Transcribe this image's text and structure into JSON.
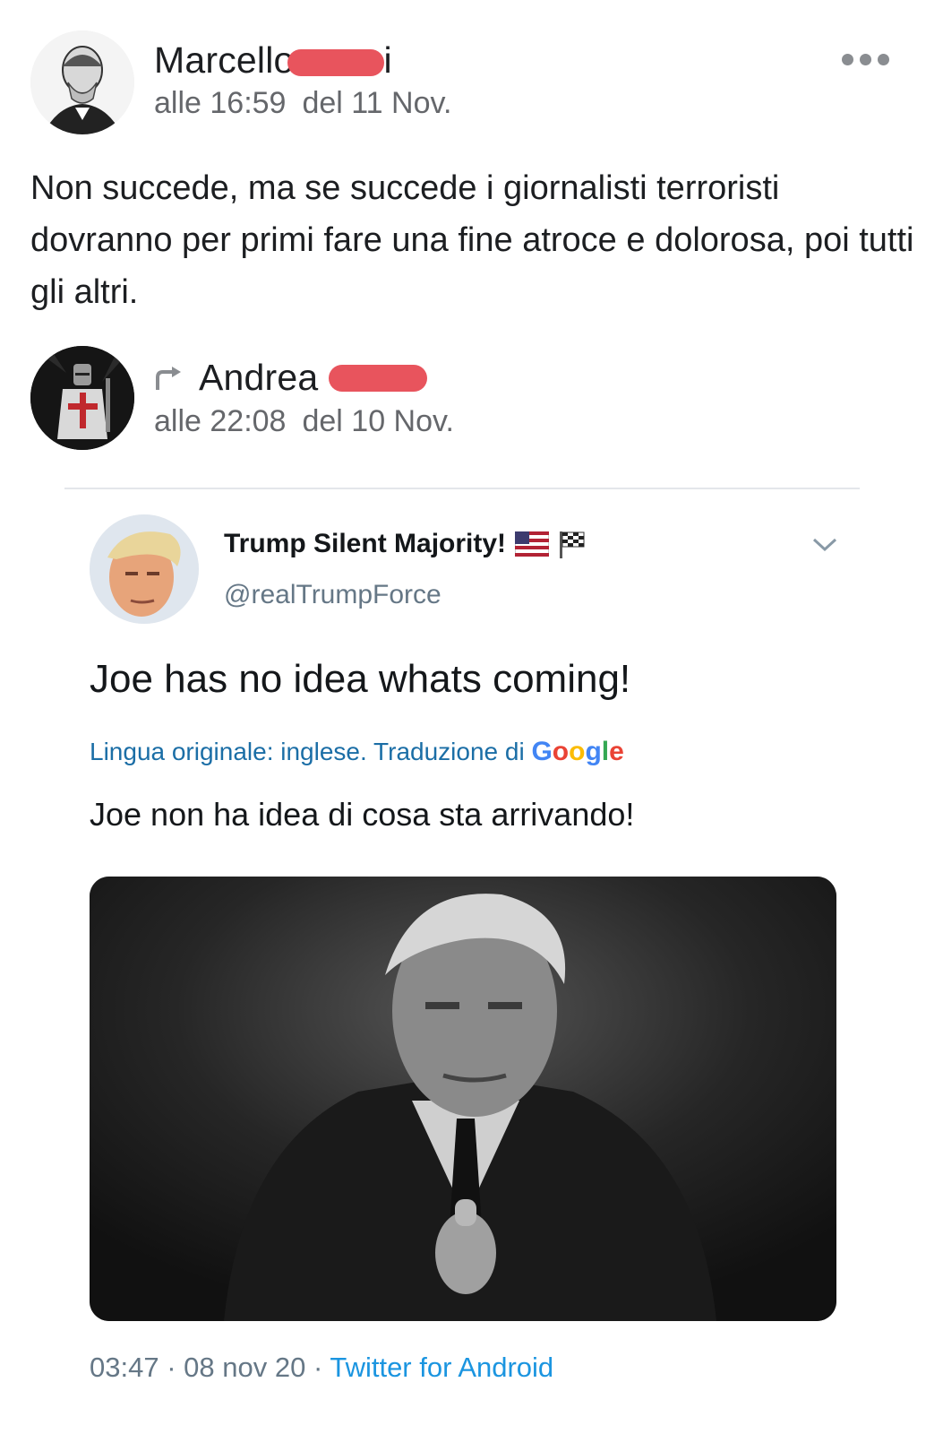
{
  "post": {
    "author_visible": "Marcello",
    "author_tail": "i",
    "time_label": "alle 16:59",
    "date_label": "del 11 Nov.",
    "text": "Non succede, ma se succede i giornalisti terroristi dovranno per primi fare una fine atroce e dolorosa, poi tutti gli altri.",
    "more_icon": "more-horizontal-icon"
  },
  "shared_from": {
    "author_visible": "Andrea",
    "time_label": "alle 22:08",
    "date_label": "del 10 Nov.",
    "icon": "share-arrow-icon"
  },
  "tweet": {
    "display_name": "Trump Silent Majority!",
    "handle": "@realTrumpForce",
    "text": "Joe has no idea whats coming!",
    "translation_label": "Lingua originale: inglese. Traduzione di",
    "translation_provider": "Google",
    "translated_text": "Joe non ha idea di cosa sta arrivando!",
    "footer_time": "03:47",
    "footer_date": "08 nov 20",
    "footer_source": "Twitter for Android",
    "separator": "·",
    "emoji_icons": [
      "us-flag-icon",
      "checkered-flag-icon"
    ],
    "chevron_icon": "chevron-down-icon"
  },
  "colors": {
    "redaction": "#e8545d",
    "link_blue": "#1b95e0",
    "translate_blue": "#1b6ea6",
    "meta_gray": "#65676b"
  }
}
